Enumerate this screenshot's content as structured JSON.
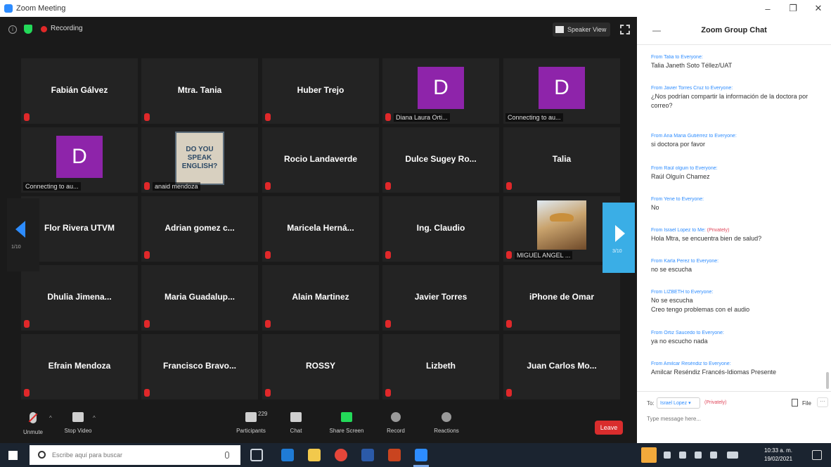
{
  "window": {
    "title": "Zoom Meeting"
  },
  "top_bar": {
    "recording_label": "Recording",
    "speaker_view_label": "Speaker View"
  },
  "tiles": [
    {
      "name": "Fabián Gálvez"
    },
    {
      "name": "Mtra. Tania"
    },
    {
      "name": "Huber Trejo"
    },
    {
      "avatar_letter": "D",
      "caption": "Diana Laura Orti..."
    },
    {
      "avatar_letter": "D",
      "caption": "Connecting to au..."
    },
    {
      "avatar_letter": "D",
      "caption": "Connecting to au..."
    },
    {
      "photo_text": [
        "DO YOU",
        "SPEAK",
        "ENGLISH?"
      ],
      "caption": "anaid mendoza"
    },
    {
      "name": "Rocio Landaverde"
    },
    {
      "name": "Dulce Sugey Ro..."
    },
    {
      "name": "Talia"
    },
    {
      "name": "Flor Rivera UTVM"
    },
    {
      "name": "Adrian gomez c..."
    },
    {
      "name": "Maricela Herná..."
    },
    {
      "name": "Ing. Claudio"
    },
    {
      "caption": "MIGUEL ANGEL ..."
    },
    {
      "name": "Dhulia Jimena..."
    },
    {
      "name": "Maria Guadalup..."
    },
    {
      "name": "Alain Martinez"
    },
    {
      "name": "Javier Torres"
    },
    {
      "name": "iPhone de Omar"
    },
    {
      "name": "Efrain Mendoza"
    },
    {
      "name": "Francisco Bravo..."
    },
    {
      "name": "ROSSY"
    },
    {
      "name": "Lizbeth"
    },
    {
      "name": "Juan Carlos Mo..."
    }
  ],
  "pager": {
    "left": "1/10",
    "right": "3/10"
  },
  "toolbar": {
    "unmute": "Unmute",
    "stop_video": "Stop Video",
    "participants": "Participants",
    "participants_count": "229",
    "chat": "Chat",
    "share_screen": "Share Screen",
    "record": "Record",
    "reactions": "Reactions",
    "leave": "Leave"
  },
  "chat": {
    "title": "Zoom Group Chat",
    "messages": [
      {
        "from": "From Talia to Everyone:",
        "text": "Talia Janeth Soto Téllez/UAT"
      },
      {
        "from": "From Javier Torres Cruz to Everyone:",
        "text": "¿Nos podrían compartir la información de la doctora por correo?"
      },
      {
        "from": "From Ana Maria Gutiérrez to Everyone:",
        "text": "si doctora por favor"
      },
      {
        "from": "From Raúl olguin to Everyone:",
        "text": "Raúl Olguín Chamez"
      },
      {
        "from": "From Yene to Everyone:",
        "text": "No"
      },
      {
        "from": "From Israel Lopez to Me:",
        "private": "(Privately)",
        "text": "Hola Mtra, se encuentra bien de salud?"
      },
      {
        "from": "From Karla Perez to Everyone:",
        "text": "no se escucha"
      },
      {
        "from": "From LIZBETH to Everyone:",
        "text": "No se escucha\nCreo tengo problemas con el audio"
      },
      {
        "from": "From Ortiz Saucedo to Everyone:",
        "text": "ya no escucho nada"
      },
      {
        "from": "From Amilcar Reséndiz to Everyone:",
        "text": "Amilcar Reséndiz Francés-Idiomas Presente"
      }
    ],
    "to_label": "To:",
    "to_value": "Israel Lopez ▾",
    "to_private": "(Privately)",
    "file_label": "File",
    "more_label": "···",
    "input_placeholder": "Type message here..."
  },
  "taskbar": {
    "search_placeholder": "Escribe aquí para buscar",
    "time": "10:33 a. m.",
    "date": "19/02/2021"
  },
  "colors": {
    "zoom_blue": "#2d8cff",
    "avatar_purple": "#8e24aa",
    "leave_red": "#d92d2d",
    "share_green": "#23d959"
  }
}
